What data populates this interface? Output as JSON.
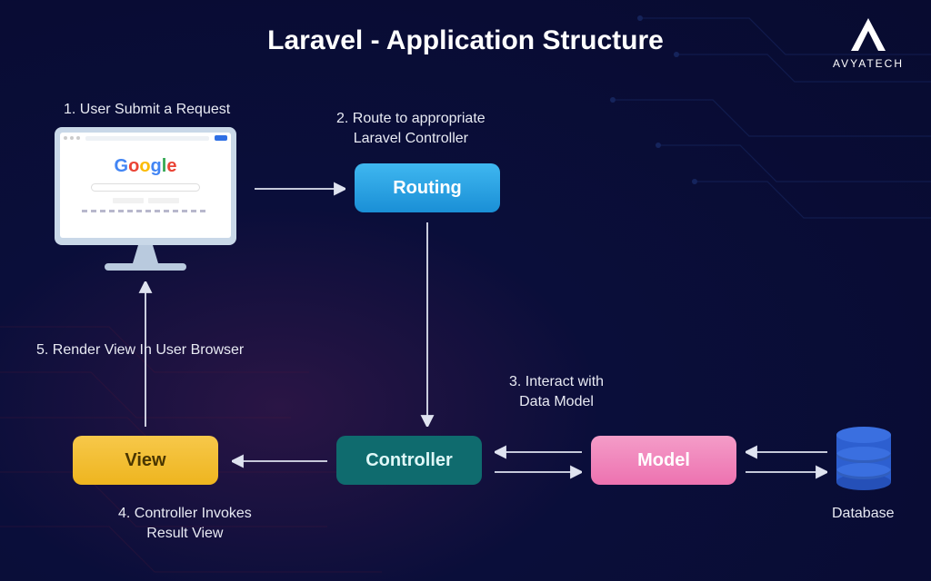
{
  "title": "Laravel - Application Structure",
  "logo_text": "AVYATECH",
  "steps": {
    "s1": "1. User Submit a Request",
    "s2_l1": "2. Route to appropriate",
    "s2_l2": "Laravel Controller",
    "s3_l1": "3. Interact with",
    "s3_l2": "Data Model",
    "s4_l1": "4. Controller Invokes",
    "s4_l2": "Result View",
    "s5": "5. Render View In User Browser"
  },
  "nodes": {
    "routing": "Routing",
    "controller": "Controller",
    "model": "Model",
    "view": "View",
    "database": "Database"
  },
  "browser": {
    "engine": "Google"
  },
  "colors": {
    "routing": "#1a8fd6",
    "controller": "#0f6b6e",
    "model": "#ed72b0",
    "view": "#eeb51f",
    "database": "#2d5fd0"
  }
}
